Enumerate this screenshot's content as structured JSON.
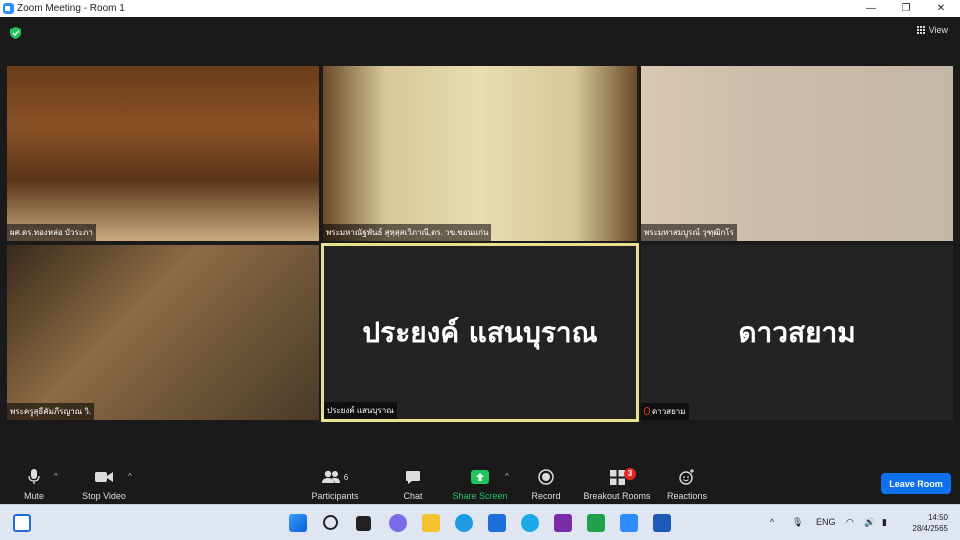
{
  "window": {
    "title": "Zoom Meeting - Room 1",
    "minimize": "—",
    "maximize": "❐",
    "close": "✕"
  },
  "view": {
    "label": "View"
  },
  "tiles": [
    {
      "name": "ผศ.ดร.ทองหล่อ บัวระภา"
    },
    {
      "name": "พระมหาณัฐพันธ์ สุหฺสฺสเวิภาณี,ดร. วข.ขอนแก่น"
    },
    {
      "name": "พระมหาสมบูรณ์ วุฑฺฒิกโร"
    },
    {
      "name": "พระครูสุธีคัมภีรญาณ วิ."
    },
    {
      "name": "ประยงค์ แสนบุราณ",
      "display": "ประยงค์ แสนบุราณ"
    },
    {
      "name": "ดาวสยาม",
      "display": "ดาวสยาม"
    }
  ],
  "toolbar": {
    "mute": "Mute",
    "stop_video": "Stop Video",
    "participants": "Participants",
    "participants_count": "6",
    "chat": "Chat",
    "share_screen": "Share Screen",
    "record": "Record",
    "breakout_rooms": "Breakout Rooms",
    "breakout_badge": "3",
    "reactions": "Reactions",
    "leave_room": "Leave Room"
  },
  "taskbar": {
    "lang": "ENG",
    "time": "14:50",
    "date": "28/4/2565"
  },
  "colors": {
    "accent": "#2d8cff",
    "share_green": "#23c55e",
    "leave_blue": "#0e71eb",
    "active_speaker": "#e8e08a"
  }
}
